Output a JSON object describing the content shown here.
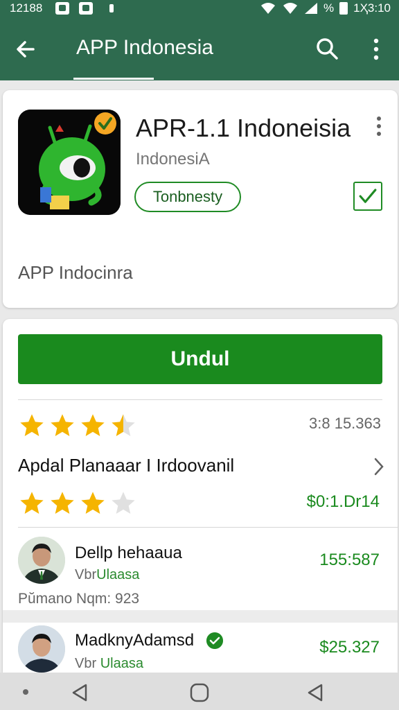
{
  "status_bar": {
    "time_left": "12188",
    "battery_label": "%",
    "time_right": "1Ҳ3:10"
  },
  "app_bar": {
    "title": "APP Indonesia",
    "back_icon": "arrow-left-icon",
    "search_icon": "search-icon",
    "more_icon": "more-vert-icon"
  },
  "app_card": {
    "name": "APR-1.1 Indoneisia",
    "subtitle": "IndonesiA",
    "tag": "Tonbnesty",
    "description": "APP Indocinra"
  },
  "main_card": {
    "download_label": "Undul",
    "rating_count": "3:8 15.363",
    "developer": "Apdal Planaaar I Irdoovanil",
    "price": "$0:1.Dr14",
    "ratings": {
      "top_stars": 3.5,
      "second_stars": 3
    }
  },
  "reviews": [
    {
      "name": "Dellp hehaaua",
      "sub_prefix": "Vbr",
      "sub_green": "Ulaasa",
      "amount": "155:587",
      "meta": "Pŭmano Nqm: 923"
    },
    {
      "name": "MadknyAdamsd",
      "sub_prefix": "Vbr",
      "sub_green": "Ulaasa",
      "amount": "$25.327"
    }
  ],
  "colors": {
    "app_bar": "#2e6b4f",
    "accent_green": "#1a8a1e",
    "star_gold": "#f5b400"
  }
}
